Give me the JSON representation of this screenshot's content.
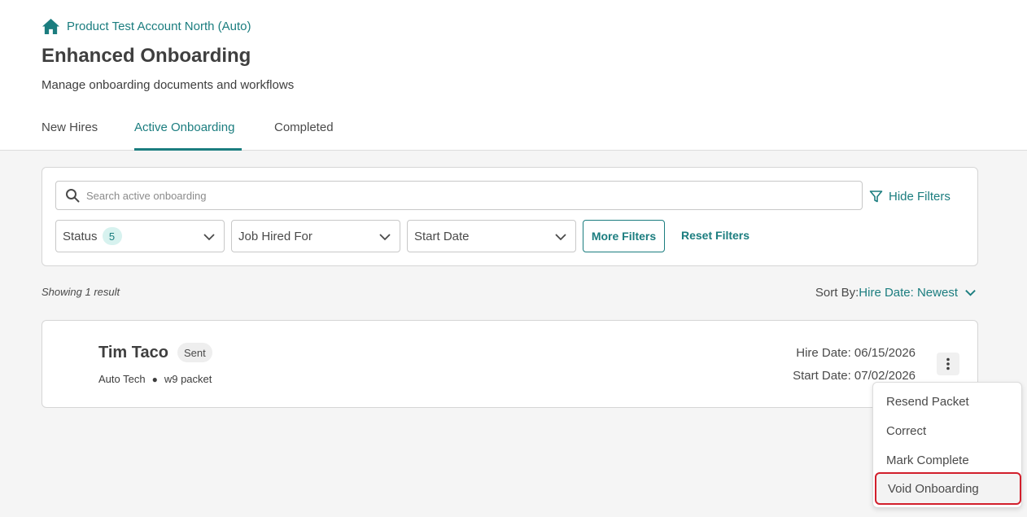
{
  "header": {
    "breadcrumb": "Product Test Account North (Auto)",
    "title": "Enhanced Onboarding",
    "subtitle": "Manage onboarding documents and workflows"
  },
  "tabs": [
    {
      "label": "New Hires",
      "active": false
    },
    {
      "label": "Active Onboarding",
      "active": true
    },
    {
      "label": "Completed",
      "active": false
    }
  ],
  "filters": {
    "search_placeholder": "Search active onboarding",
    "hide_filters": "Hide Filters",
    "status_label": "Status",
    "status_count": "5",
    "job_label": "Job Hired For",
    "start_date_label": "Start Date",
    "more_filters": "More Filters",
    "reset_filters": "Reset Filters"
  },
  "results": {
    "showing": "Showing 1 result",
    "sort_label": "Sort By:",
    "sort_value": "Hire Date: Newest"
  },
  "result_card": {
    "name": "Tim Taco",
    "status": "Sent",
    "job": "Auto Tech",
    "packet": "w9 packet",
    "hire_date": "Hire Date: 06/15/2026",
    "start_date": "Start Date: 07/02/2026"
  },
  "menu": {
    "items": [
      "Resend Packet",
      "Correct",
      "Mark Complete",
      "Void Onboarding"
    ]
  },
  "colors": {
    "accent": "#1b7d7f",
    "highlight_border": "#d21f2c"
  }
}
